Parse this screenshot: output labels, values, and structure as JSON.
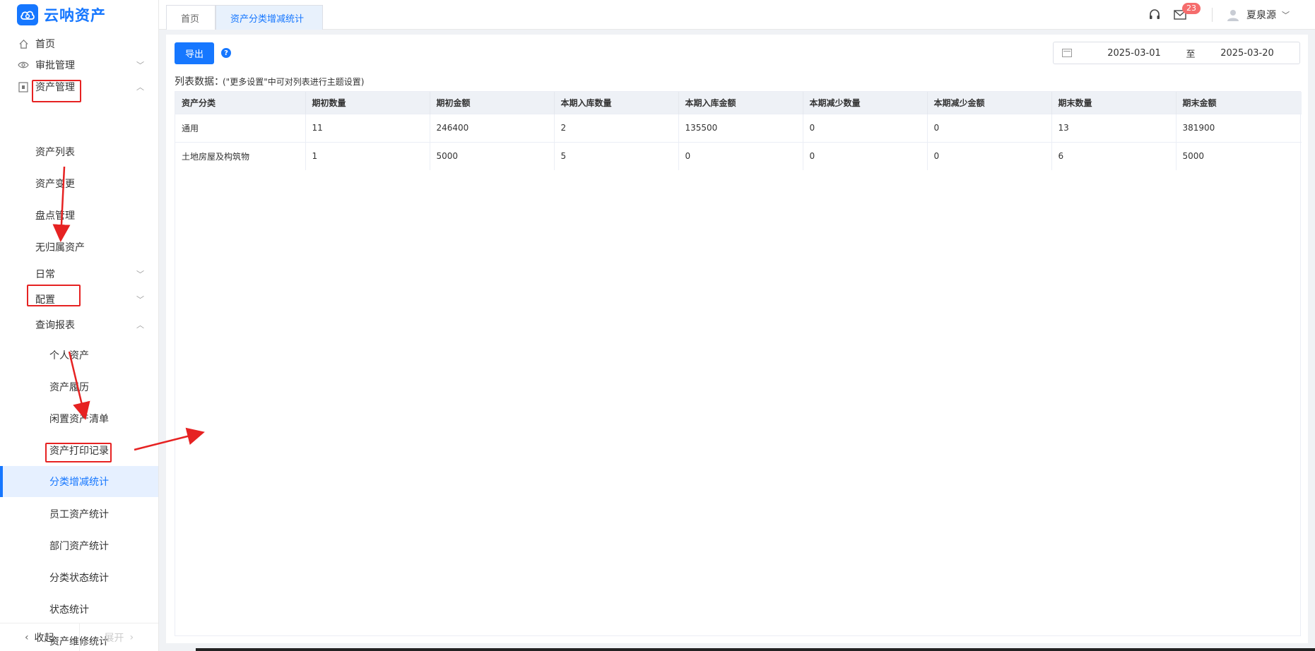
{
  "app": {
    "name": "云呐资产"
  },
  "tabs": [
    {
      "label": "首页",
      "active": false
    },
    {
      "label": "资产分类增减统计",
      "active": true
    }
  ],
  "header": {
    "mail_count": "23",
    "username": "夏泉源"
  },
  "sidebar": {
    "items": [
      {
        "label": "首页"
      },
      {
        "label": "审批管理"
      },
      {
        "label": "资产管理"
      },
      {
        "label": "资产列表"
      },
      {
        "label": "资产变更"
      },
      {
        "label": "盘点管理"
      },
      {
        "label": "无归属资产"
      },
      {
        "label": "日常"
      },
      {
        "label": "配置"
      },
      {
        "label": "查询报表"
      },
      {
        "label": "个人资产"
      },
      {
        "label": "资产履历"
      },
      {
        "label": "闲置资产清单"
      },
      {
        "label": "资产打印记录"
      },
      {
        "label": "分类增减统计"
      },
      {
        "label": "员工资产统计"
      },
      {
        "label": "部门资产统计"
      },
      {
        "label": "分类状态统计"
      },
      {
        "label": "状态统计"
      },
      {
        "label": "资产维修统计"
      }
    ],
    "collapse_label": "收起",
    "expand_label": "展开"
  },
  "toolbar": {
    "export_label": "导出",
    "help_glyph": "?"
  },
  "daterange": {
    "start": "2025-03-01",
    "sep": "至",
    "end": "2025-03-20"
  },
  "list": {
    "label": "列表数据：",
    "hint": "(\"更多设置\"中可对列表进行主题设置)"
  },
  "table": {
    "columns": [
      "资产分类",
      "期初数量",
      "期初金额",
      "本期入库数量",
      "本期入库金额",
      "本期减少数量",
      "本期减少金额",
      "期末数量",
      "期末金额"
    ],
    "rows": [
      [
        "通用",
        "11",
        "246400",
        "2",
        "135500",
        "0",
        "0",
        "13",
        "381900"
      ],
      [
        "土地房屋及构筑物",
        "1",
        "5000",
        "5",
        "0",
        "0",
        "0",
        "6",
        "5000"
      ]
    ]
  },
  "colors": {
    "accent": "#1677ff",
    "annotation": "#e62222",
    "badge": "#f56c6c"
  }
}
